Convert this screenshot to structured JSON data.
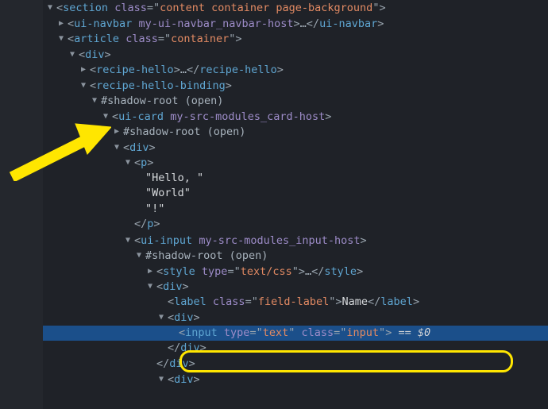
{
  "colors": {
    "tag": "#5fa6d2",
    "attr": "#9d8cc8",
    "val": "#e28a63",
    "text": "#d6d9dc"
  },
  "selected_suffix": " == $0",
  "lines": [
    {
      "indent": 0,
      "arrow": "open",
      "kind": "open",
      "tag": "section",
      "attrs": [
        [
          "class",
          "content container page-background"
        ]
      ]
    },
    {
      "indent": 1,
      "arrow": "closed",
      "kind": "openclose",
      "tag": "ui-navbar",
      "attrs": [
        [
          "my-ui-navbar_navbar-host",
          null
        ]
      ]
    },
    {
      "indent": 1,
      "arrow": "open",
      "kind": "open",
      "tag": "article",
      "attrs": [
        [
          "class",
          "container"
        ]
      ]
    },
    {
      "indent": 2,
      "arrow": "open",
      "kind": "open",
      "tag": "div",
      "attrs": []
    },
    {
      "indent": 3,
      "arrow": "closed",
      "kind": "openclose",
      "tag": "recipe-hello",
      "attrs": []
    },
    {
      "indent": 3,
      "arrow": "open",
      "kind": "open",
      "tag": "recipe-hello-binding",
      "attrs": []
    },
    {
      "indent": 4,
      "arrow": "open",
      "kind": "shadow",
      "text": "#shadow-root (open)"
    },
    {
      "indent": 5,
      "arrow": "open",
      "kind": "open",
      "tag": "ui-card",
      "attrs": [
        [
          "my-src-modules_card-host",
          null
        ]
      ]
    },
    {
      "indent": 6,
      "arrow": "closed",
      "kind": "shadow",
      "text": "#shadow-root (open)"
    },
    {
      "indent": 6,
      "arrow": "open",
      "kind": "open",
      "tag": "div",
      "attrs": []
    },
    {
      "indent": 7,
      "arrow": "open",
      "kind": "open",
      "tag": "p",
      "attrs": []
    },
    {
      "indent": 8,
      "arrow": "none",
      "kind": "text",
      "text": "\"Hello, \""
    },
    {
      "indent": 8,
      "arrow": "none",
      "kind": "text",
      "text": "\"World\""
    },
    {
      "indent": 8,
      "arrow": "none",
      "kind": "text",
      "text": "\"!\""
    },
    {
      "indent": 7,
      "arrow": "none",
      "kind": "close",
      "tag": "p"
    },
    {
      "indent": 7,
      "arrow": "open",
      "kind": "open",
      "tag": "ui-input",
      "attrs": [
        [
          "my-src-modules_input-host",
          null
        ]
      ]
    },
    {
      "indent": 8,
      "arrow": "open",
      "kind": "shadow",
      "text": "#shadow-root (open)"
    },
    {
      "indent": 9,
      "arrow": "closed",
      "kind": "openclose",
      "tag": "style",
      "attrs": [
        [
          "type",
          "text/css"
        ]
      ]
    },
    {
      "indent": 9,
      "arrow": "open",
      "kind": "open",
      "tag": "div",
      "attrs": []
    },
    {
      "indent": 10,
      "arrow": "none",
      "kind": "inline",
      "tag": "label",
      "attrs": [
        [
          "class",
          "field-label"
        ]
      ],
      "inner": "Name"
    },
    {
      "indent": 10,
      "arrow": "open",
      "kind": "open",
      "tag": "div",
      "attrs": []
    },
    {
      "indent": 11,
      "arrow": "none",
      "kind": "self",
      "tag": "input",
      "attrs": [
        [
          "type",
          "text"
        ],
        [
          "class",
          "input"
        ]
      ],
      "selected": true
    },
    {
      "indent": 10,
      "arrow": "none",
      "kind": "close",
      "tag": "div"
    },
    {
      "indent": 9,
      "arrow": "none",
      "kind": "close",
      "tag": "div"
    },
    {
      "indent": 10,
      "arrow": "open",
      "kind": "open",
      "tag": "div",
      "attrs": []
    }
  ]
}
